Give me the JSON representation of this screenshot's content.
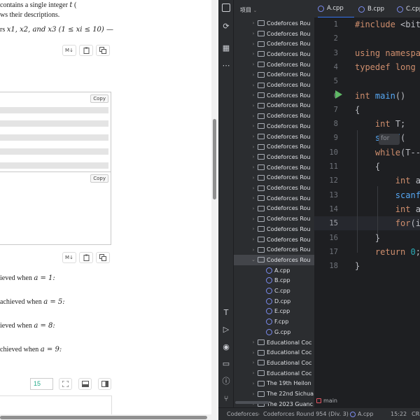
{
  "problem": {
    "line1": "contains a single integer",
    "line1_var": "t",
    "line1_tail": "(",
    "line2": "ws their descriptions.",
    "line3_prefix": "rs",
    "line3_math": "x1, x2, and x3 (1 ≤ xi ≤ 10) —",
    "toolbar_md": "M↓",
    "copy_label": "Copy",
    "notes": [
      {
        "text": "ieved when",
        "math": "a = 1:"
      },
      {
        "text": "achieved when",
        "math": "a = 5:"
      },
      {
        "text": "ieved when",
        "math": "a = 8:"
      },
      {
        "text": "chieved when",
        "math": "a = 9:"
      }
    ],
    "font_size_value": "15"
  },
  "ide": {
    "project_label": "项目",
    "tabs": [
      "A.cpp",
      "B.cpp",
      "C.cpp"
    ],
    "tree": [
      {
        "label": "Codeforces Rou",
        "type": "folder",
        "expanded": false
      },
      {
        "label": "Codeforces Rou",
        "type": "folder",
        "expanded": false
      },
      {
        "label": "Codeforces Rou",
        "type": "folder",
        "expanded": false
      },
      {
        "label": "Codeforces Rou",
        "type": "folder",
        "expanded": false
      },
      {
        "label": "Codeforces Rou",
        "type": "folder",
        "expanded": false
      },
      {
        "label": "Codeforces Rou",
        "type": "folder",
        "expanded": false
      },
      {
        "label": "Codeforces Rou",
        "type": "folder",
        "expanded": false
      },
      {
        "label": "Codeforces Rou",
        "type": "folder",
        "expanded": false
      },
      {
        "label": "Codeforces Rou",
        "type": "folder",
        "expanded": false
      },
      {
        "label": "Codeforces Rou",
        "type": "folder",
        "expanded": false
      },
      {
        "label": "Codeforces Rou",
        "type": "folder",
        "expanded": false
      },
      {
        "label": "Codeforces Rou",
        "type": "folder",
        "expanded": false
      },
      {
        "label": "Codeforces Rou",
        "type": "folder",
        "expanded": false
      },
      {
        "label": "Codeforces Rou",
        "type": "folder",
        "expanded": false
      },
      {
        "label": "Codeforces Rou",
        "type": "folder",
        "expanded": false
      },
      {
        "label": "Codeforces Rou",
        "type": "folder",
        "expanded": false
      },
      {
        "label": "Codeforces Rou",
        "type": "folder",
        "expanded": false
      },
      {
        "label": "Codeforces Rou",
        "type": "folder",
        "expanded": false
      },
      {
        "label": "Codeforces Rou",
        "type": "folder",
        "expanded": false
      },
      {
        "label": "Codeforces Rou",
        "type": "folder",
        "expanded": false
      },
      {
        "label": "Codeforces Rou",
        "type": "folder",
        "expanded": false
      },
      {
        "label": "Codeforces Rou",
        "type": "folder",
        "expanded": false
      },
      {
        "label": "Codeforces Rou",
        "type": "folder",
        "expanded": false
      },
      {
        "label": "Codeforces Rou",
        "type": "folder",
        "expanded": true,
        "selected": true
      },
      {
        "label": "A.cpp",
        "type": "file"
      },
      {
        "label": "B.cpp",
        "type": "file"
      },
      {
        "label": "C.cpp",
        "type": "file"
      },
      {
        "label": "D.cpp",
        "type": "file"
      },
      {
        "label": "E.cpp",
        "type": "file"
      },
      {
        "label": "F.cpp",
        "type": "file"
      },
      {
        "label": "G.cpp",
        "type": "file"
      },
      {
        "label": "Educational Coc",
        "type": "folder",
        "expanded": false
      },
      {
        "label": "Educational Coc",
        "type": "folder",
        "expanded": false
      },
      {
        "label": "Educational Coc",
        "type": "folder",
        "expanded": false
      },
      {
        "label": "Educational Coc",
        "type": "folder",
        "expanded": false
      },
      {
        "label": "The 19th Heilon",
        "type": "folder",
        "expanded": false
      },
      {
        "label": "The 22nd Sichua",
        "type": "folder",
        "expanded": false
      },
      {
        "label": "The 2023 Guanc",
        "type": "folder",
        "expanded": false
      }
    ],
    "line_numbers": [
      "1",
      "2",
      "3",
      "4",
      "5",
      "6",
      "7",
      "8",
      "9",
      "10",
      "11",
      "12",
      "13",
      "14",
      "15",
      "16",
      "17",
      "18"
    ],
    "current_line": "15",
    "hint": "for",
    "code": [
      "#include <bit",
      "",
      "using namespa",
      "typedef long",
      "",
      "int main()",
      "{",
      "    int T;",
      "    scanf(",
      "    while(T--",
      "    {",
      "        int a",
      "        scanf",
      "        int a",
      "        for(i",
      "    }",
      "    return 0;",
      "}"
    ],
    "branch": "main",
    "status": {
      "crumb1": "Codeforces",
      "crumb2": "Codeforces Round 954 (Div. 3)",
      "crumb3": "A.cpp",
      "position": "15:22",
      "encoding": "CRL"
    }
  }
}
